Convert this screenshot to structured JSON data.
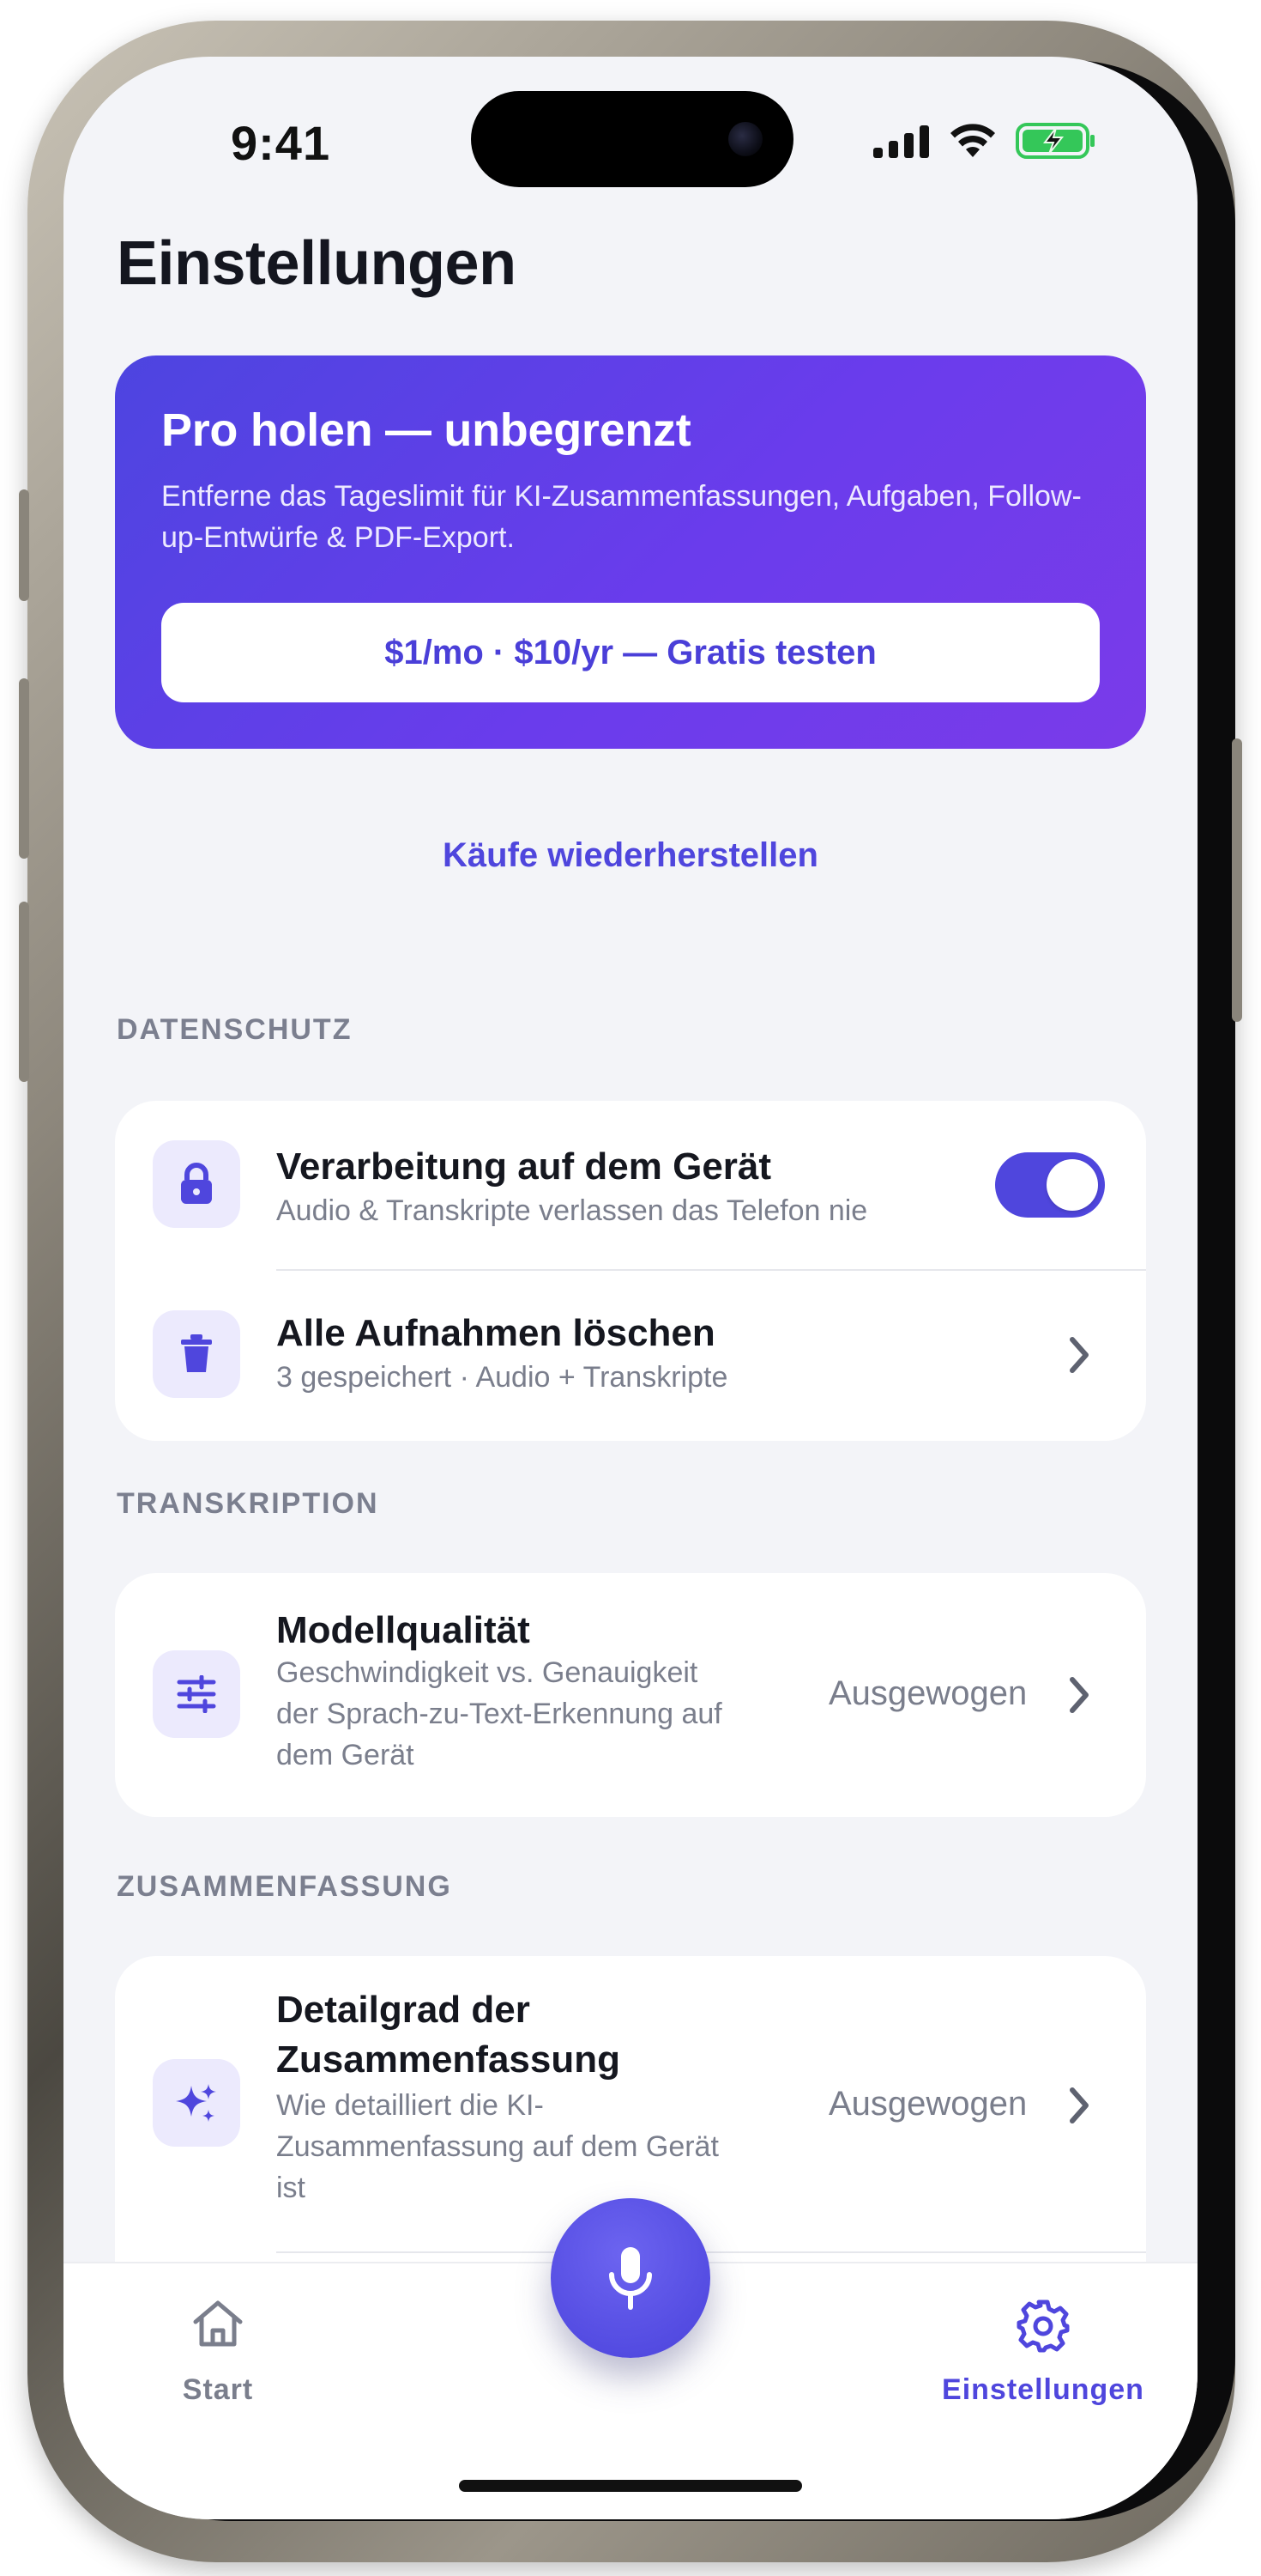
{
  "status_bar": {
    "time": "9:41"
  },
  "header": {
    "title": "Einstellungen"
  },
  "promo": {
    "title": "Pro holen — unbegrenzt",
    "description": "Entferne das Tageslimit für KI-Zusammenfassungen, Aufgaben, Follow-up-Entwürfe & PDF-Export.",
    "button_label": "$1/mo · $10/yr — Gratis testen",
    "colors": {
      "gradient_start": "#4d45e0",
      "gradient_end": "#7a3be9"
    }
  },
  "restore_label": "Käufe wiederherstellen",
  "sections": {
    "privacy": {
      "header": "DATENSCHUTZ",
      "items": [
        {
          "title": "Verarbeitung auf dem Gerät",
          "subtitle": "Audio & Transkripte verlassen das Telefon nie",
          "icon": "lock-icon",
          "toggle_on": true
        },
        {
          "title": "Alle Aufnahmen löschen",
          "subtitle": "3 gespeichert · Audio + Transkripte",
          "icon": "trash-icon"
        }
      ]
    },
    "transcription": {
      "header": "TRANSKRIPTION",
      "items": [
        {
          "title": "Modellqualität",
          "subtitle_lines": [
            "Geschwindigkeit vs. Genauigkeit",
            "der Sprach-zu-Text-Erkennung auf",
            "dem Gerät"
          ],
          "value": "Ausgewogen",
          "icon": "sliders-icon"
        }
      ]
    },
    "summary": {
      "header": "ZUSAMMENFASSUNG",
      "items": [
        {
          "title_lines": [
            "Detailgrad der",
            "Zusammenfassung"
          ],
          "subtitle_lines": [
            "Wie detailliert die KI-",
            "Zusammenfassung auf dem Gerät",
            "ist"
          ],
          "value": "Ausgewogen",
          "icon": "sparkles-icon"
        }
      ]
    }
  },
  "tab_bar": {
    "tabs": [
      {
        "label": "Start",
        "icon": "home-icon",
        "active": false
      },
      {
        "label": "Einstellungen",
        "icon": "gear-icon",
        "active": true
      }
    ],
    "record_button_icon": "microphone-icon"
  },
  "colors": {
    "accent": "#4f46dd",
    "background": "#f3f4f8",
    "inactive": "#7a7e8c"
  }
}
